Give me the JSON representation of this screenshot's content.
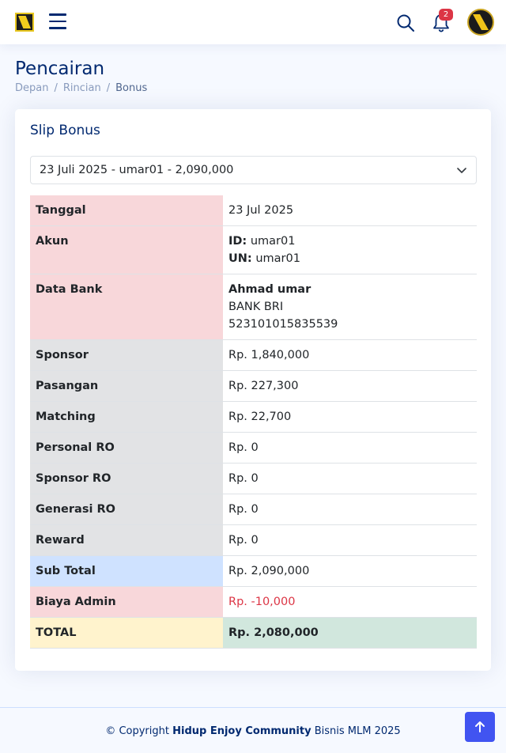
{
  "header": {
    "notification_count": "2"
  },
  "page": {
    "title": "Pencairan",
    "breadcrumb": [
      "Depan",
      "Rincian",
      "Bonus"
    ]
  },
  "card": {
    "title": "Slip Bonus",
    "select_value": "23 Juli 2025 - umar01 - 2,090,000"
  },
  "rows": {
    "tanggal": {
      "label": "Tanggal",
      "value": "23 Jul 2025"
    },
    "akun": {
      "label": "Akun",
      "id_label": "ID:",
      "id_value": "umar01",
      "un_label": "UN:",
      "un_value": "umar01"
    },
    "bank": {
      "label": "Data Bank",
      "name": "Ahmad umar",
      "bank": "BANK BRI",
      "account": "523101015835539"
    },
    "sponsor": {
      "label": "Sponsor",
      "value": "Rp. 1,840,000"
    },
    "pasangan": {
      "label": "Pasangan",
      "value": "Rp. 227,300"
    },
    "matching": {
      "label": "Matching",
      "value": "Rp. 22,700"
    },
    "personal_ro": {
      "label": "Personal RO",
      "value": "Rp. 0"
    },
    "sponsor_ro": {
      "label": "Sponsor RO",
      "value": "Rp. 0"
    },
    "generasi_ro": {
      "label": "Generasi RO",
      "value": "Rp. 0"
    },
    "reward": {
      "label": "Reward",
      "value": "Rp. 0"
    },
    "sub_total": {
      "label": "Sub Total",
      "value": "Rp. 2,090,000"
    },
    "biaya_admin": {
      "label": "Biaya Admin",
      "value": "Rp. -10,000"
    },
    "total": {
      "label": "TOTAL",
      "value": "Rp. 2,080,000"
    }
  },
  "footer": {
    "prefix": "© Copyright",
    "brand": "Hidup Enjoy Community",
    "suffix": "Bisnis MLM 2025"
  },
  "colors": {
    "primary": "#012970",
    "accent": "#4154f1",
    "danger": "#dc3545"
  }
}
